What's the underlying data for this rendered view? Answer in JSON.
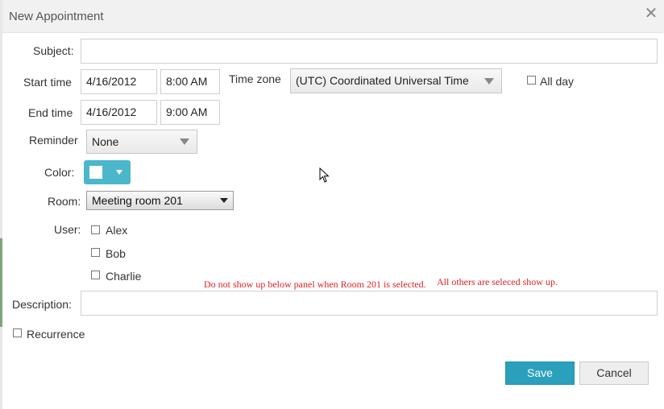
{
  "window": {
    "title": "New Appointment",
    "close_glyph": "✕"
  },
  "form": {
    "subject_label": "Subject:",
    "subject_value": "",
    "start_label": "Start time",
    "start_date": "4/16/2012",
    "start_time": "8:00 AM",
    "timezone_label": "Time zone",
    "timezone_value": "(UTC) Coordinated Universal Time",
    "allday_label": "All day",
    "end_label": "End time",
    "end_date": "4/16/2012",
    "end_time": "9:00 AM",
    "reminder_label": "Reminder",
    "reminder_value": "None",
    "color_label": "Color:",
    "room_label": "Room:",
    "room_value": "Meeting room 201",
    "user_label": "User:",
    "users": [
      "Alex",
      "Bob",
      "Charlie"
    ],
    "description_label": "Description:",
    "description_value": "",
    "recurrence_label": "Recurrence"
  },
  "annotations": {
    "note_left": "Do not show up below panel when Room 201 is selected.",
    "note_right": "All others are seleced show up."
  },
  "buttons": {
    "save": "Save",
    "cancel": "Cancel"
  },
  "colors": {
    "accent": "#2aa0bd",
    "color_button": "#4bb7cc",
    "note": "#e02020"
  }
}
